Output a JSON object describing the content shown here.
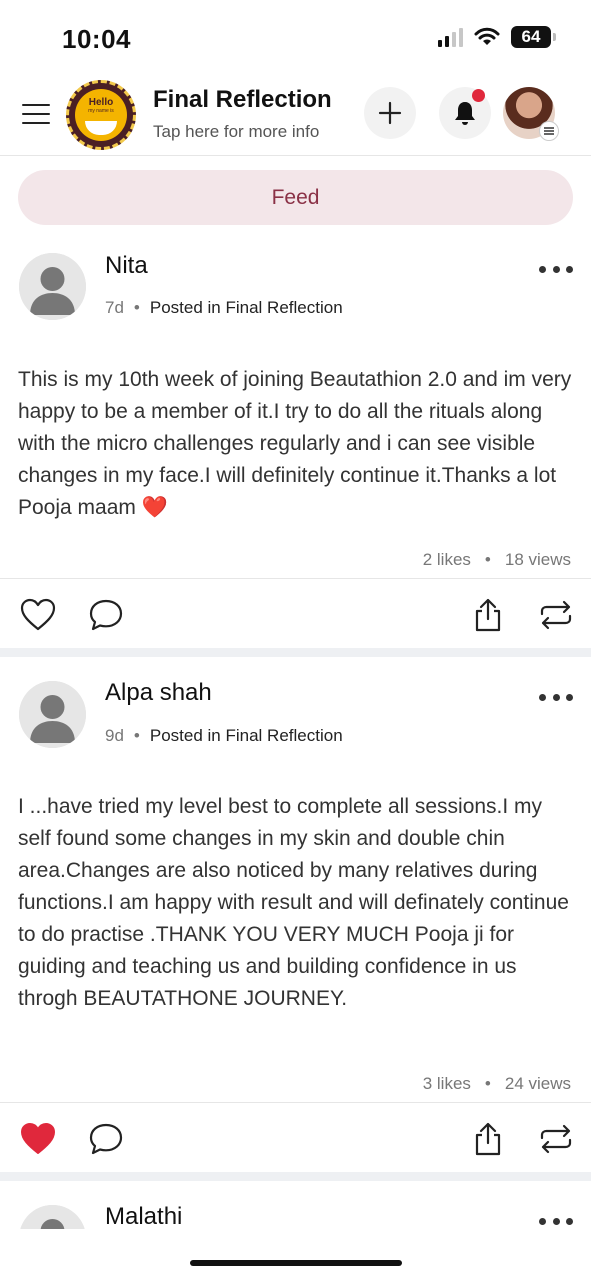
{
  "status_bar": {
    "time": "10:04",
    "battery": "64"
  },
  "header": {
    "logo_text": "Hello",
    "logo_subtext": "my name is",
    "title": "Final Reflection",
    "subtitle": "Tap here for more info"
  },
  "tabs": {
    "feed_label": "Feed"
  },
  "posts": [
    {
      "author": "Nita",
      "age": "7d",
      "posted_in": "Posted in Final Reflection",
      "body": "This is my 10th week of joining Beautathion 2.0 and im very happy to be a member of it.I  try to do all the rituals along with the micro challenges regularly and i can see visible changes in my face.I will definitely continue it.Thanks a lot Pooja  maam ❤️",
      "likes": "2 likes",
      "views": "18 views",
      "liked": false
    },
    {
      "author": "Alpa shah",
      "age": "9d",
      "posted_in": "Posted in Final Reflection",
      "body": "I ...have tried my level best to complete all sessions.I my self found some changes in my skin and double chin area.Changes are also noticed by many relatives during functions.I am happy with result and will definately continue to do practise .THANK YOU VERY MUCH Pooja ji for guiding and teaching us and building confidence in us throgh BEAUTATHONE JOURNEY.",
      "likes": "3 likes",
      "views": "24 views",
      "liked": true
    },
    {
      "author": "Malathi"
    }
  ],
  "colors": {
    "accent": "#8a3146",
    "feed_tab_bg": "#f3e6e9",
    "like_active": "#e0283c",
    "notification_dot": "#e0283c"
  }
}
